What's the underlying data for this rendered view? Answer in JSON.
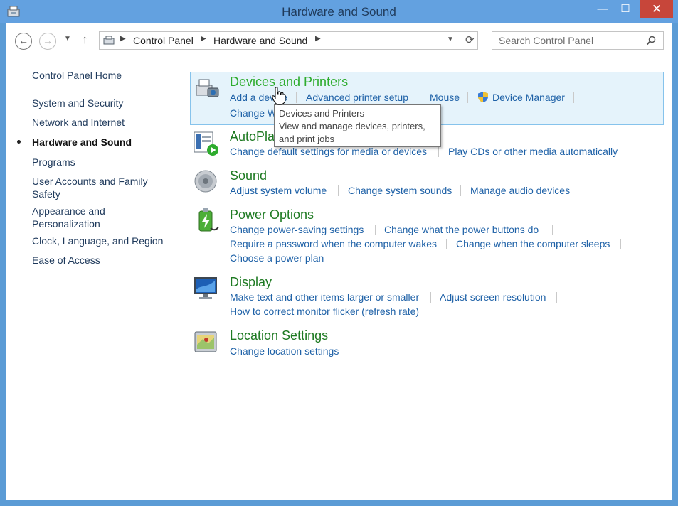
{
  "window": {
    "title": "Hardware and Sound",
    "icon": "control-panel-icon"
  },
  "controls": {
    "minimize": "—",
    "maximize": "☐",
    "close": "✕"
  },
  "nav": {
    "back": "←",
    "forward": "→",
    "recent": "▼",
    "up": "↑"
  },
  "address": {
    "crumbs": [
      "Control Panel",
      "Hardware and Sound"
    ],
    "separator": "▶",
    "dropdown": "▼",
    "refresh": "⟳"
  },
  "search": {
    "placeholder": "Search Control Panel"
  },
  "sidebar": {
    "items": [
      "Control Panel Home",
      "System and Security",
      "Network and Internet",
      "Hardware and Sound",
      "Programs",
      "User Accounts and Family",
      "Safety",
      "Appearance and",
      "Personalization",
      "Clock, Language, and Region",
      "Ease of Access"
    ],
    "current": "Hardware and Sound"
  },
  "categories": {
    "devices": {
      "title": "Devices and Printers",
      "links": [
        "Add a device",
        "Advanced printer setup",
        "Mouse",
        "Device Manager",
        "Change Windows To Go startup options"
      ]
    },
    "autoplay": {
      "title": "AutoPlay",
      "links": [
        "Change default settings for media or devices",
        "Play CDs or other media automatically"
      ]
    },
    "sound": {
      "title": "Sound",
      "links": [
        "Adjust system volume",
        "Change system sounds",
        "Manage audio devices"
      ]
    },
    "power": {
      "title": "Power Options",
      "links": [
        "Change power-saving settings",
        "Change what the power buttons do",
        "Require a password when the computer wakes",
        "Change when the computer sleeps",
        "Choose a power plan"
      ]
    },
    "display": {
      "title": "Display",
      "links": [
        "Make text and other items larger or smaller",
        "Adjust screen resolution",
        "How to correct monitor flicker (refresh rate)"
      ]
    },
    "location": {
      "title": "Location Settings",
      "links": [
        "Change location settings"
      ]
    }
  },
  "tooltip": {
    "lines": [
      "Devices and Printers",
      "View and manage devices, printers,",
      "and print jobs"
    ]
  },
  "colors": {
    "titlebar": "#63a1e0",
    "link": "#1e61a7",
    "category_title": "#1e7a22",
    "hover_title": "#2eac2e",
    "highlight": "#e5f3fb"
  }
}
